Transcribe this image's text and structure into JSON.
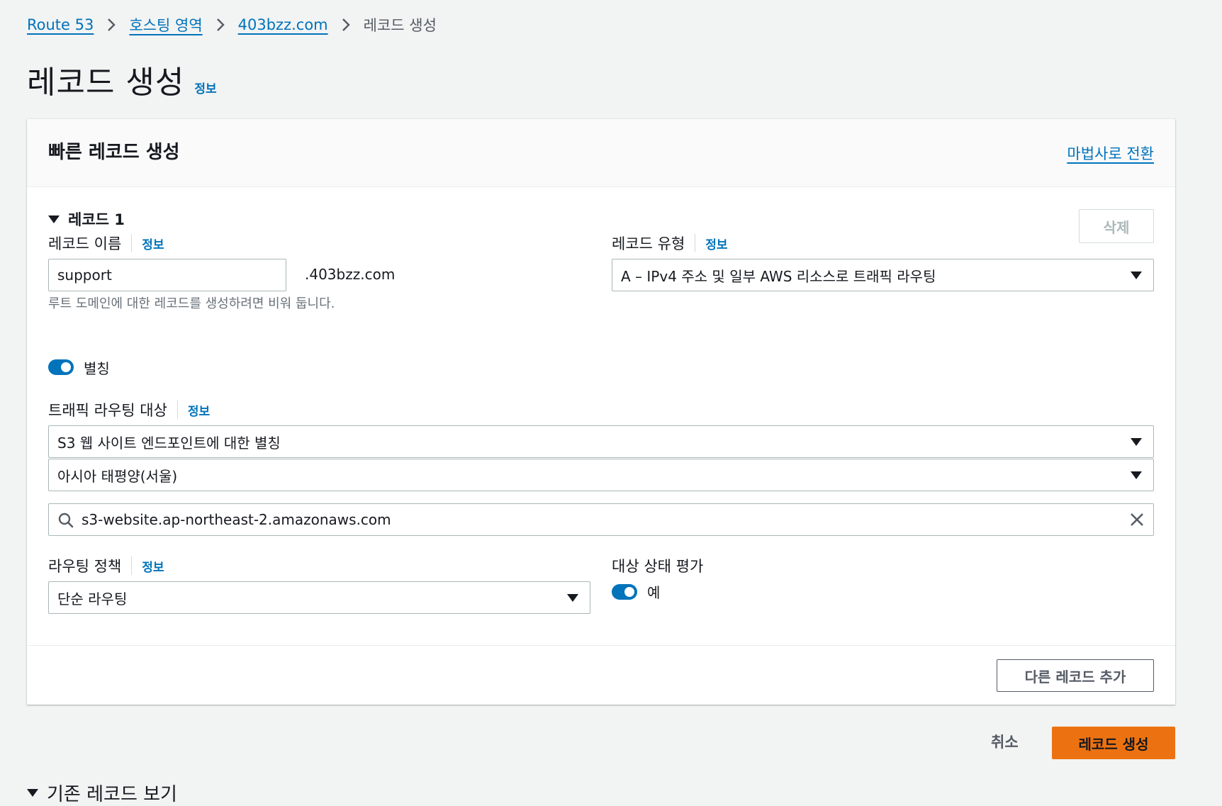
{
  "breadcrumb": {
    "items": [
      "Route 53",
      "호스팅 영역",
      "403bzz.com"
    ],
    "current": "레코드 생성"
  },
  "header": {
    "title": "레코드 생성",
    "info": "정보"
  },
  "panel": {
    "title": "빠른 레코드 생성",
    "wizard_link": "마법사로 전환",
    "record_title": "레코드 1",
    "delete_label": "삭제",
    "record_name": {
      "label": "레코드 이름",
      "info": "정보",
      "value": "support",
      "suffix": ".403bzz.com",
      "hint": "루트 도메인에 대한 레코드를 생성하려면 비워 둡니다."
    },
    "record_type": {
      "label": "레코드 유형",
      "info": "정보",
      "value": "A – IPv4 주소 및 일부 AWS 리소스로 트래픽 라우팅"
    },
    "alias": {
      "label": "별칭",
      "enabled": true
    },
    "routing_target": {
      "label": "트래픽 라우팅 대상",
      "info": "정보",
      "endpoint": "S3 웹 사이트 엔드포인트에 대한 별칭",
      "region": "아시아 태평양(서울)",
      "search_value": "s3-website.ap-northeast-2.amazonaws.com"
    },
    "routing_policy": {
      "label": "라우팅 정책",
      "info": "정보",
      "value": "단순 라우팅"
    },
    "health": {
      "label": "대상 상태 평가",
      "toggle_label": "예",
      "enabled": true
    },
    "add_record_label": "다른 레코드 추가"
  },
  "actions": {
    "cancel": "취소",
    "create": "레코드 생성"
  },
  "existing": {
    "label": "기존 레코드 보기"
  },
  "colors": {
    "link": "#0073bb",
    "primary": "#ec7211",
    "toggle": "#0073bb"
  },
  "icons": [
    "chevron-right-icon",
    "caret-down-icon",
    "search-icon",
    "close-icon"
  ]
}
